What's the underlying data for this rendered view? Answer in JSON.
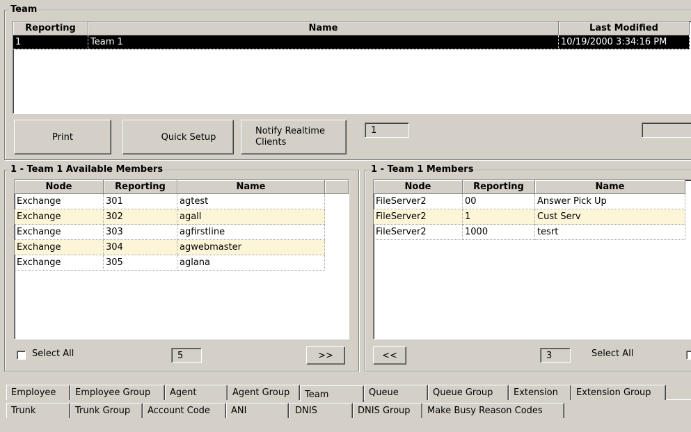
{
  "team_group": {
    "title": "Team",
    "columns": [
      "Reporting",
      "Name",
      "Last Modified"
    ],
    "rows": [
      {
        "reporting": "1",
        "name": "Team 1",
        "last_modified": "10/19/2000 3:34:16 PM",
        "selected": true
      }
    ],
    "print_label": "Print",
    "quick_setup_label": "Quick Setup",
    "notify_label": "Notify Realtime Clients",
    "count": "1"
  },
  "available": {
    "title": "1 - Team 1 Available Members",
    "columns": [
      "Node",
      "Reporting",
      "Name"
    ],
    "rows": [
      {
        "node": "Exchange",
        "reporting": "301",
        "name": "agtest"
      },
      {
        "node": "Exchange",
        "reporting": "302",
        "name": "agall"
      },
      {
        "node": "Exchange",
        "reporting": "303",
        "name": "agfirstline"
      },
      {
        "node": "Exchange",
        "reporting": "304",
        "name": "agwebmaster"
      },
      {
        "node": "Exchange",
        "reporting": "305",
        "name": "aglana"
      }
    ],
    "select_all_label": "Select All",
    "count": "5",
    "add_label": ">>"
  },
  "members": {
    "title": "1 - Team 1 Members",
    "columns": [
      "Node",
      "Reporting",
      "Name"
    ],
    "rows": [
      {
        "node": "FileServer2",
        "reporting": "00",
        "name": "Answer Pick Up"
      },
      {
        "node": "FileServer2",
        "reporting": "1",
        "name": "Cust Serv"
      },
      {
        "node": "FileServer2",
        "reporting": "1000",
        "name": "tesrt"
      }
    ],
    "remove_label": "<<",
    "count": "3",
    "select_all_label": "Select All"
  },
  "tabs_row1": [
    "Employee",
    "Employee Group",
    "Agent",
    "Agent Group",
    "Team",
    "Queue",
    "Queue Group",
    "Extension",
    "Extension Group"
  ],
  "tabs_row2": [
    "Trunk",
    "Trunk Group",
    "Account Code",
    "ANI",
    "DNIS",
    "DNIS Group",
    "Make Busy Reason Codes"
  ],
  "active_tab": "Team"
}
